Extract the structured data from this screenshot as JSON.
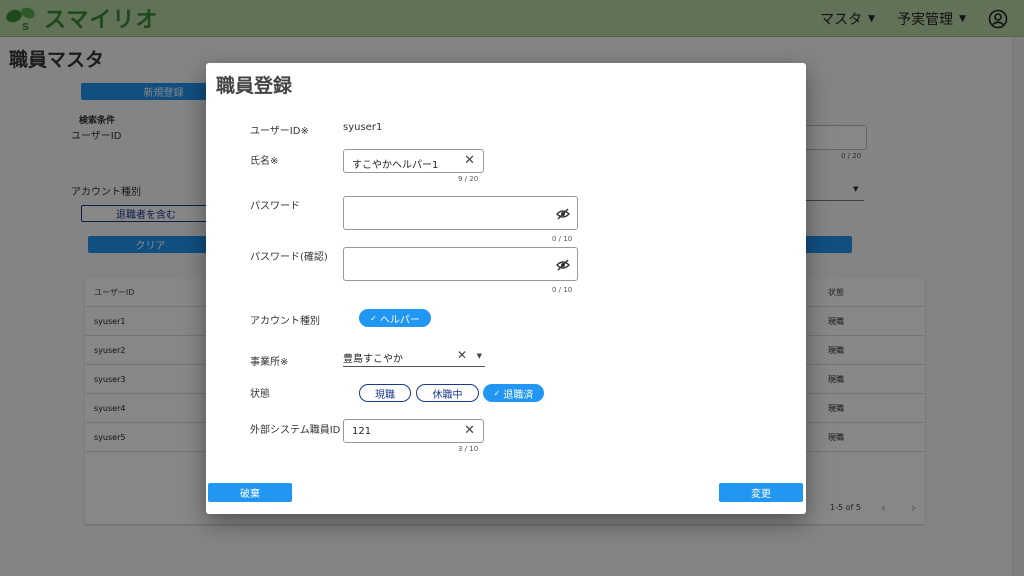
{
  "header": {
    "app_name": "スマイリオ",
    "nav": [
      "マスタ",
      "予実管理"
    ],
    "brand_color": "#b9d8a8"
  },
  "page": {
    "title": "職員マスタ",
    "new_button": "新規登録",
    "search_heading": "検索条件",
    "user_id_label": "ユーザーID",
    "user_id_counter": "0 / 20",
    "account_type_label": "アカウント種別",
    "include_retired_button": "退職者を含む",
    "clear_button": "クリア",
    "table": {
      "headers": [
        "ユーザーID",
        "状態"
      ],
      "rows": [
        {
          "user_id": "syuser1",
          "status": "現職"
        },
        {
          "user_id": "syuser2",
          "status": "現職"
        },
        {
          "user_id": "syuser3",
          "status": "現職"
        },
        {
          "user_id": "syuser4",
          "status": "現職"
        },
        {
          "user_id": "syuser5",
          "status": "現職"
        }
      ],
      "pagination": "1-5 of 5"
    }
  },
  "dialog": {
    "title": "職員登録",
    "user_id_label": "ユーザーID※",
    "user_id_value": "syuser1",
    "name_label": "氏名※",
    "name_value": "すこやかヘルパー1",
    "name_counter": "9 / 20",
    "password_label": "パスワード",
    "password_counter": "0 / 10",
    "password_confirm_label": "パスワード(確認)",
    "password_confirm_counter": "0 / 10",
    "account_type_label": "アカウント種別",
    "account_type_chip": "ヘルパー",
    "office_label": "事業所※",
    "office_value": "豊島すこやか",
    "status_label": "状態",
    "status_chips": [
      {
        "label": "現職",
        "selected": false
      },
      {
        "label": "休職中",
        "selected": false
      },
      {
        "label": "退職済",
        "selected": true
      }
    ],
    "external_id_label": "外部システム職員ID",
    "external_id_value": "121",
    "external_id_counter": "3 / 10",
    "discard_button": "破棄",
    "change_button": "変更"
  },
  "colors": {
    "accent": "#2196f3",
    "chip_outline": "#1a3a8f"
  }
}
